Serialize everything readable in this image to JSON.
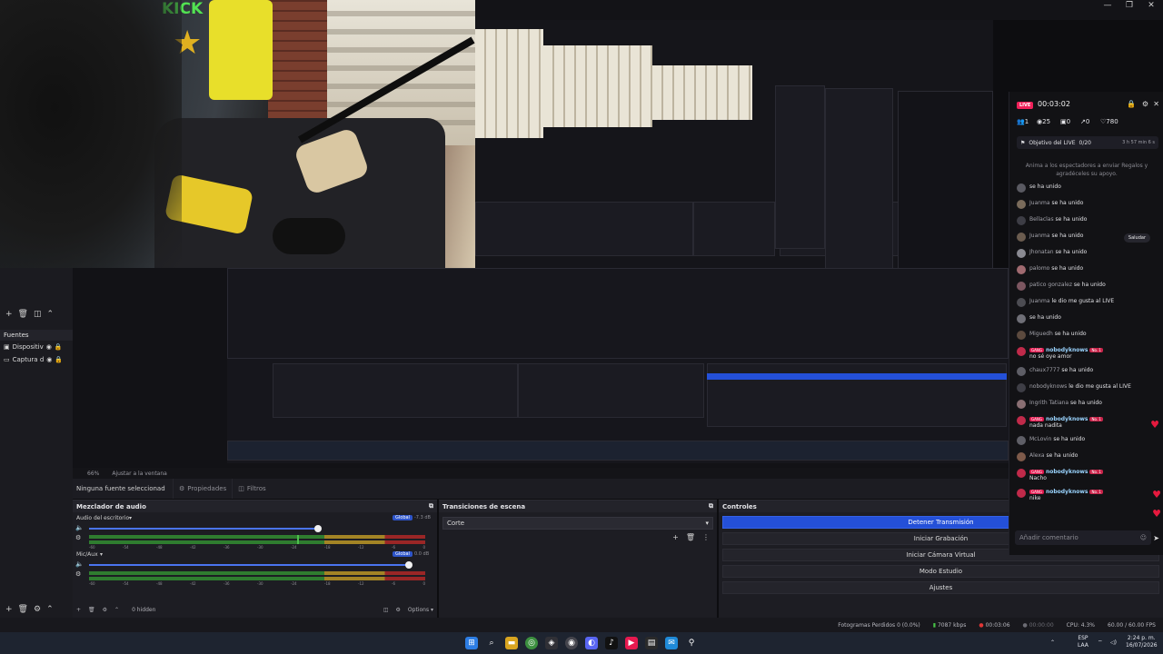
{
  "window": {
    "minimize": "—",
    "maximize": "❐",
    "close": "✕"
  },
  "camera": {
    "wall_text": "KICK"
  },
  "sources": {
    "title": "Fuentes",
    "items": [
      {
        "label": "Dispositiv"
      },
      {
        "label": "Captura d"
      }
    ]
  },
  "zoom": {
    "level": "66%",
    "fit": "Ajustar a la ventana"
  },
  "source_toolbar": {
    "none_selected": "Ninguna fuente seleccionad",
    "properties": "Propiedades",
    "filters": "Filtros"
  },
  "mixer": {
    "title": "Mezclador de audio",
    "tracks": [
      {
        "name": "Audio del escritorio",
        "scope": "Global",
        "db": "-7.3 dB",
        "volume_pct": 73,
        "level_pct": 62
      },
      {
        "name": "Mic/Aux",
        "scope": "Global",
        "db": "0.0 dB",
        "volume_pct": 100,
        "level_pct": 0
      }
    ],
    "scale": [
      "-60",
      "-54",
      "-48",
      "-42",
      "-36",
      "-30",
      "-24",
      "-18",
      "-12",
      "-6",
      "0"
    ],
    "hidden_count": "0 hidden",
    "options": "Options"
  },
  "transitions": {
    "title": "Transiciones de escena",
    "selected": "Corte"
  },
  "controls": {
    "title": "Controles",
    "buttons": [
      {
        "label": "Detener Transmisión",
        "active": true
      },
      {
        "label": "Iniciar Grabación",
        "active": false
      },
      {
        "label": "Iniciar Cámara Virtual",
        "active": false
      },
      {
        "label": "Modo Estudio",
        "active": false
      },
      {
        "label": "Ajustes",
        "active": false
      }
    ]
  },
  "status": {
    "dropped": "Fotogramas Perdidos 0 (0.0%)",
    "bitrate": "7087 kbps",
    "live_time": "00:03:06",
    "rec_time": "00:00:00",
    "cpu": "CPU: 4.3%",
    "fps": "60.00 / 60.00 FPS"
  },
  "taskbar": {
    "lang_top": "ESP",
    "lang_bottom": "LAA",
    "time": "2:24 p. m.",
    "date": "16/07/2026"
  },
  "live": {
    "badge": "LIVE",
    "time": "00:03:02",
    "stats": {
      "viewers": "1",
      "watchers": "25",
      "gifts": "0",
      "shares": "0",
      "likes": "780"
    },
    "goal": {
      "label": "Objetivo del LIVE",
      "value": "0/20",
      "remaining": "3 h 57 min 6 s"
    },
    "encourage": "Anima a los espectadores a enviar Regalos y agradéceles su apoyo.",
    "saludar": "Saludar",
    "chat": [
      {
        "name": "",
        "text": "se ha unido",
        "badge": ""
      },
      {
        "name": "Juanma",
        "text": "se ha unido",
        "badge": ""
      },
      {
        "name": "Bellaclas",
        "text": "se ha unido",
        "badge": ""
      },
      {
        "name": "Juanma",
        "text": "se ha unido",
        "badge": ""
      },
      {
        "name": "Jhonatan",
        "text": "se ha unido",
        "badge": ""
      },
      {
        "name": "palomo",
        "text": "se ha unido",
        "badge": ""
      },
      {
        "name": "patico gonzalez",
        "text": "se ha unido",
        "badge": ""
      },
      {
        "name": "Juanma",
        "text": "le dio me gusta al LIVE",
        "badge": ""
      },
      {
        "name": "",
        "text": "se ha unido",
        "badge": ""
      },
      {
        "name": "Miguedh",
        "text": "se ha unido",
        "badge": ""
      },
      {
        "name": "nobodyknows",
        "text": "no sé oye amor",
        "badge": "GANG"
      },
      {
        "name": "chaux7777",
        "text": "se ha unido",
        "badge": ""
      },
      {
        "name": "nobodyknows",
        "text": "le dio me gusta al LIVE",
        "badge": ""
      },
      {
        "name": "Ingrith Tatiana",
        "text": "se ha unido",
        "badge": ""
      },
      {
        "name": "nobodyknows",
        "text": "nada nadita",
        "badge": "GANG"
      },
      {
        "name": "McLovin",
        "text": "se ha unido",
        "badge": ""
      },
      {
        "name": "Alexa",
        "text": "se ha unido",
        "badge": ""
      },
      {
        "name": "nobodyknows",
        "text": "Nacho",
        "badge": "GANG"
      },
      {
        "name": "nobodyknows",
        "text": "nike",
        "badge": "GANG"
      }
    ],
    "level_badge": "No. 1",
    "comment_placeholder": "Añadir comentario"
  }
}
